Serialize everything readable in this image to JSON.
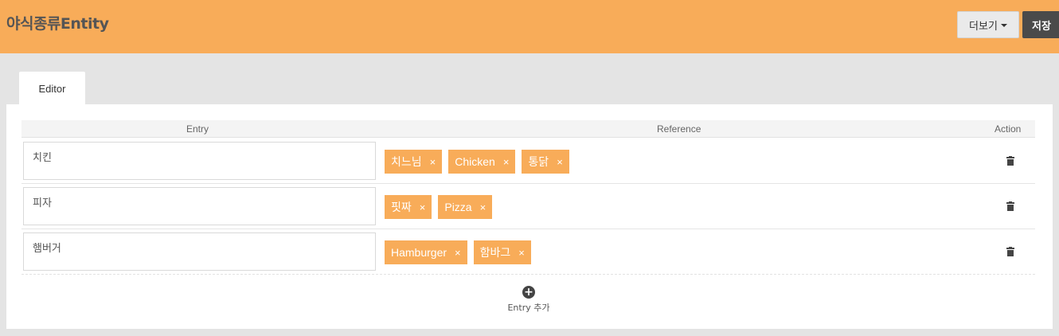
{
  "header": {
    "title": "야식종류Entity",
    "more_label": "더보기",
    "save_label": "저장"
  },
  "tabs": [
    {
      "label": "Editor"
    }
  ],
  "table": {
    "headers": {
      "entry": "Entry",
      "reference": "Reference",
      "action": "Action"
    },
    "rows": [
      {
        "entry": "치킨",
        "references": [
          "치느님",
          "Chicken",
          "통닭"
        ]
      },
      {
        "entry": "피자",
        "references": [
          "핏짜",
          "Pizza"
        ]
      },
      {
        "entry": "햄버거",
        "references": [
          "Hamburger",
          "함바그"
        ]
      }
    ],
    "tag_remove": "×",
    "delete_icon": "trash-icon"
  },
  "add_entry": {
    "icon": "plus-circle-icon",
    "label": "Entry 추가"
  },
  "colors": {
    "accent": "#f8ac59",
    "save_button": "#4a4a4a"
  }
}
